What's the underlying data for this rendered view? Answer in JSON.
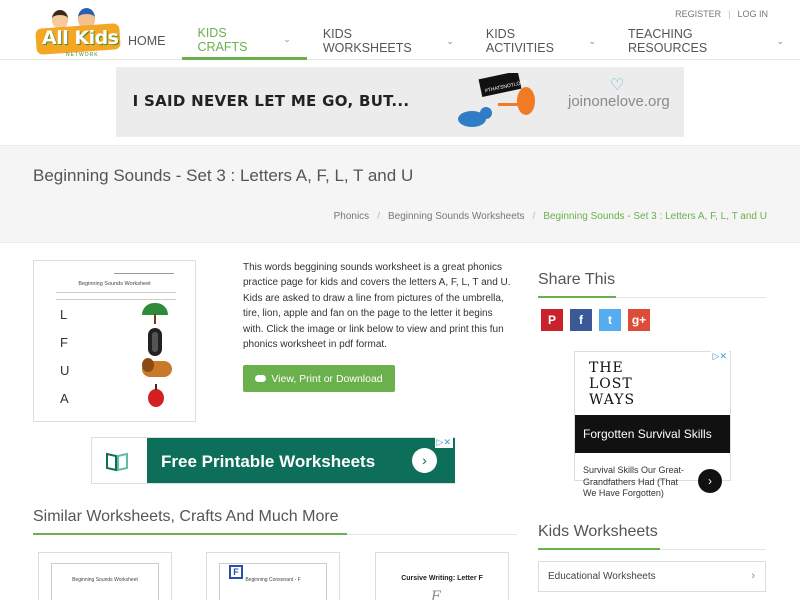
{
  "header": {
    "logo_text": "All Kids",
    "logo_sub": "NETWORK",
    "top_links": [
      "REGISTER",
      "LOG IN"
    ],
    "nav": [
      {
        "label": "HOME",
        "has_menu": false,
        "active": false
      },
      {
        "label": "KIDS CRAFTS",
        "has_menu": true,
        "active": true
      },
      {
        "label": "KIDS WORKSHEETS",
        "has_menu": true,
        "active": false
      },
      {
        "label": "KIDS ACTIVITIES",
        "has_menu": true,
        "active": false
      },
      {
        "label": "TEACHING RESOURCES",
        "has_menu": true,
        "active": false
      }
    ]
  },
  "banner_ad": {
    "headline": "I SAID NEVER LET ME GO, BUT...",
    "sign_text": "#THATSNOTLOVE",
    "brand": "joinonelove.org"
  },
  "page": {
    "title": "Beginning Sounds - Set 3 : Letters A, F, L, T and U",
    "breadcrumb": [
      "Phonics",
      "Beginning Sounds Worksheets",
      "Beginning Sounds - Set 3 : Letters A, F, L, T and U"
    ]
  },
  "worksheet": {
    "thumb_title": "Beginning Sounds Worksheet",
    "letters": [
      "L",
      "F",
      "U",
      "A"
    ],
    "description": "This words beggining sounds worksheet is a great phonics practice page for kids and covers the letters A, F, L, T and U. Kids are asked to draw a line from pictures of the umbrella, tire, lion, apple and fan on the page to the letter it begins with. Click the image or link below to view and print this fun phonics worksheet in pdf format.",
    "button_label": "View, Print or Download"
  },
  "worksheets_ad": {
    "label": "Free Printable Worksheets",
    "arrow": "›"
  },
  "similar": {
    "title": "Similar Worksheets, Crafts And Much More",
    "cards": [
      {
        "caption": "Beginning Sounds Worksheet"
      },
      {
        "caption": "Beginning Consonant - F",
        "letter": "F"
      },
      {
        "caption": "Cursive Writing: Letter F",
        "glyph": "F"
      }
    ]
  },
  "sidebar": {
    "share_title": "Share This",
    "social": [
      "P",
      "f",
      "t",
      "g+"
    ],
    "ad": {
      "book_title": [
        "THE",
        "LOST",
        "WAYS"
      ],
      "dark_label": "Forgotten Survival Skills",
      "text": "Survival Skills Our Great-Grandfathers Had (That We Have Forgotten)",
      "arrow": "›"
    },
    "kids_worksheets_title": "Kids Worksheets",
    "kids_worksheets_items": [
      "Educational Worksheets"
    ]
  },
  "colors": {
    "accent": "#6ab04c",
    "ad_green": "#0d6e5a",
    "pinterest": "#c8232c",
    "facebook": "#3b5998",
    "twitter": "#55acee",
    "googleplus": "#dd4b39"
  },
  "icons": [
    "chevron-down-icon",
    "cloud-download-icon",
    "adchoices-icon",
    "close-icon",
    "chevron-right-icon",
    "book-icon"
  ]
}
